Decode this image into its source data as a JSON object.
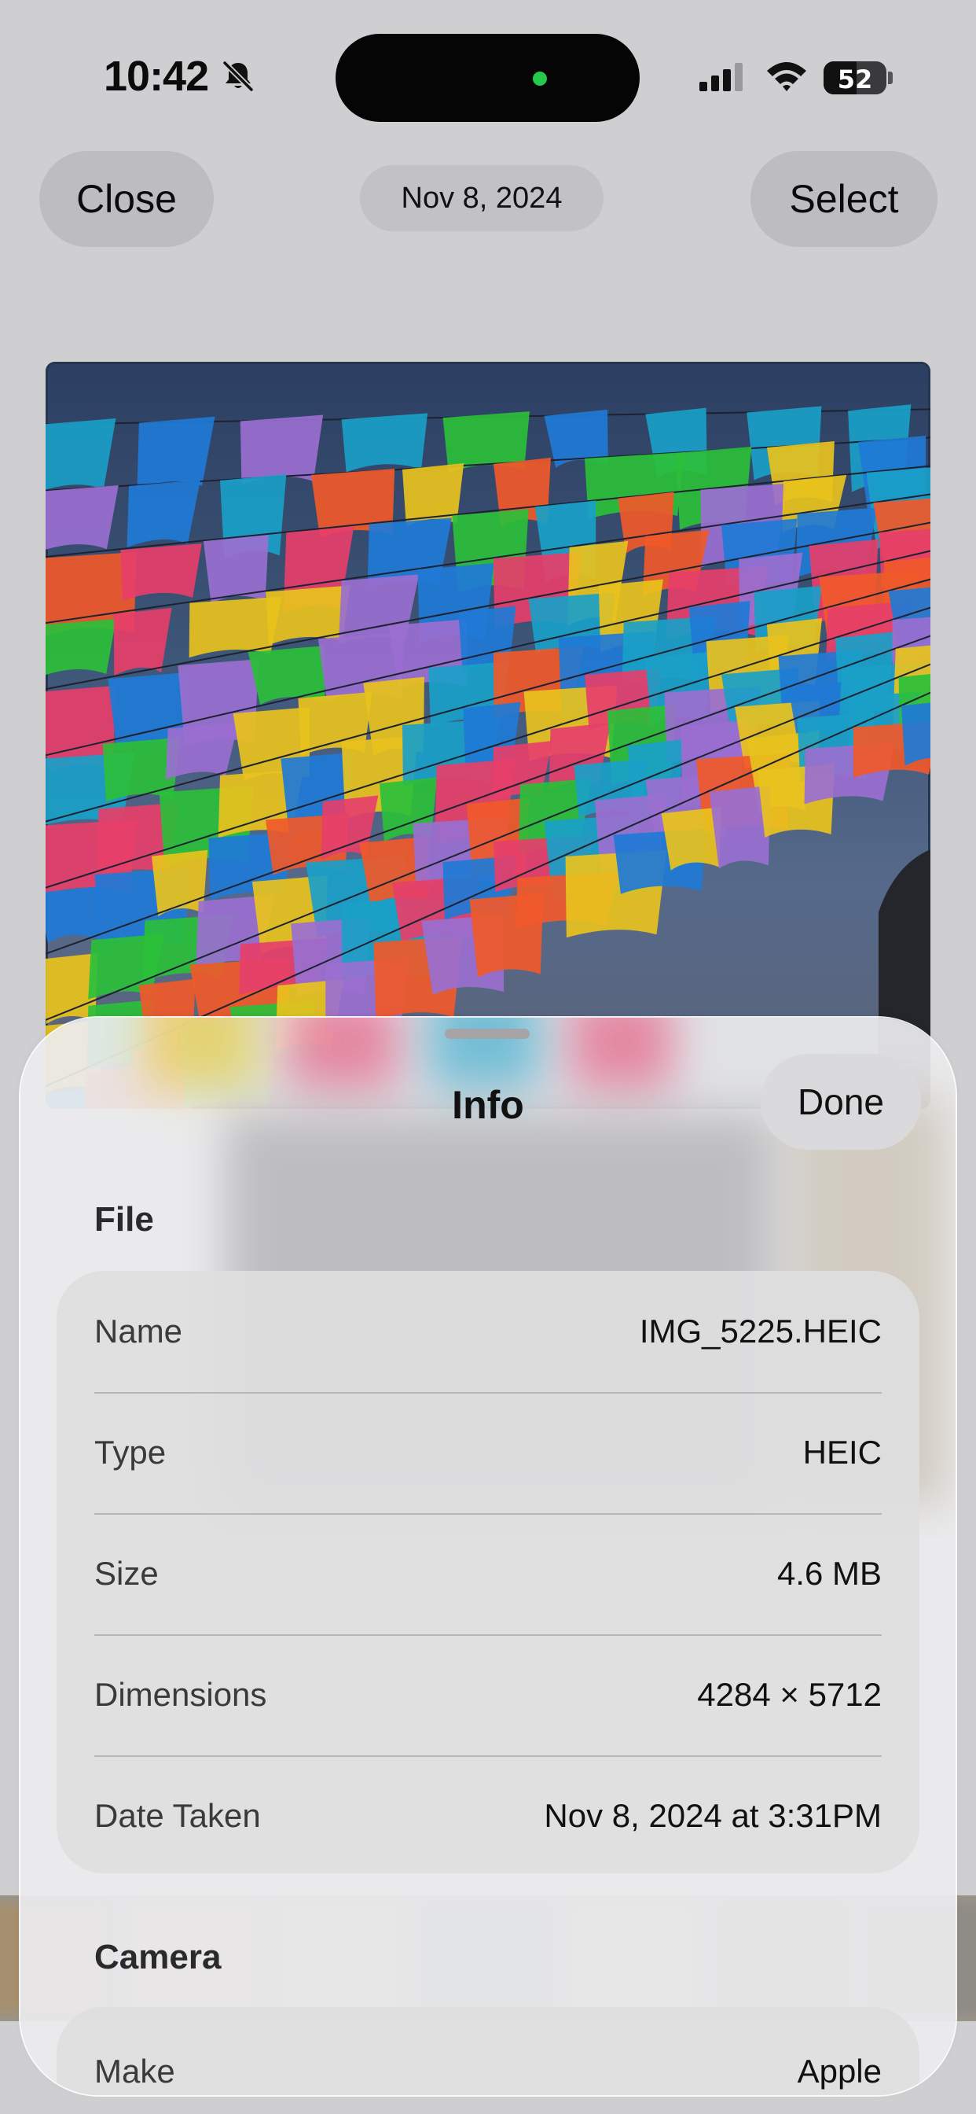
{
  "status_bar": {
    "time": "10:42",
    "battery": "52",
    "battery_level_percent": 52,
    "icons": [
      "bell-slash-icon",
      "cellular-signal-icon",
      "wifi-icon",
      "battery-icon"
    ]
  },
  "top_bar": {
    "close_label": "Close",
    "date_label": "Nov 8, 2024",
    "select_label": "Select"
  },
  "info_sheet": {
    "title": "Info",
    "done_label": "Done",
    "file_section": {
      "title": "File",
      "rows": [
        {
          "label": "Name",
          "value": "IMG_5225.HEIC"
        },
        {
          "label": "Type",
          "value": "HEIC"
        },
        {
          "label": "Size",
          "value": "4.6 MB"
        },
        {
          "label": "Dimensions",
          "value": "4284 × 5712"
        },
        {
          "label": "Date Taken",
          "value": "Nov 8, 2024 at 3:31PM"
        }
      ]
    },
    "camera_section": {
      "title": "Camera",
      "rows": [
        {
          "label": "Make",
          "value": "Apple"
        }
      ]
    }
  },
  "colors": {
    "background": "#cfcfd1",
    "dynamic_island_dot": "#25c84a",
    "sheet": "#ececee",
    "flag_palette": [
      "#e8c21d",
      "#1aa0c8",
      "#e63f6a",
      "#2bbf3a",
      "#f0592a",
      "#9a6fd0",
      "#1f7ad6"
    ]
  }
}
